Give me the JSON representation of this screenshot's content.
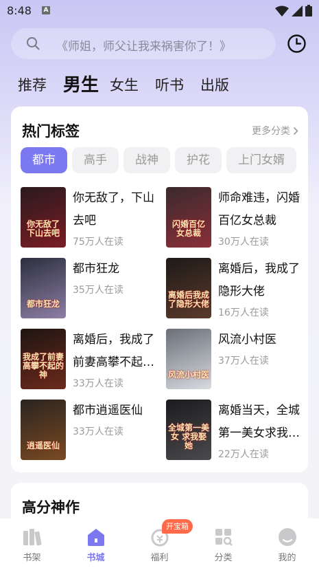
{
  "status": {
    "time": "8:48",
    "app_indicator": "A"
  },
  "search": {
    "placeholder": "《师姐，师父让我来祸害你了！》"
  },
  "categories": [
    {
      "label": "推荐",
      "active": false
    },
    {
      "label": "男生",
      "active": true
    },
    {
      "label": "女生",
      "active": false
    },
    {
      "label": "听书",
      "active": false
    },
    {
      "label": "出版",
      "active": false
    }
  ],
  "hot_tags": {
    "title": "热门标签",
    "more_label": "更多分类",
    "tags": [
      "都市",
      "高手",
      "战神",
      "护花",
      "上门女婿"
    ],
    "active_tag": "都市",
    "books": [
      {
        "title": "你无敌了，下山去吧",
        "readers": "75万人在读",
        "cover_text": "你无敌了 下山去吧",
        "cover_colors": [
          "#2a1a1e",
          "#7a1d24"
        ]
      },
      {
        "title": "师命难违，闪婚百亿女总裁",
        "readers": "30万人在读",
        "cover_text": "闪婚百亿 女总裁",
        "cover_colors": [
          "#3a2a2c",
          "#8a2f3a"
        ]
      },
      {
        "title": "都市狂龙",
        "readers": "35万人在读",
        "cover_text": "都市狂龙",
        "cover_colors": [
          "#2c2f3e",
          "#8d7fa6"
        ]
      },
      {
        "title": "离婚后，我成了隐形大佬",
        "readers": "16万人在读",
        "cover_text": "离婚后我成了隐形大佬",
        "cover_colors": [
          "#1e1a18",
          "#5a3a2a"
        ]
      },
      {
        "title": "离婚后，我成了前妻高攀不起的神",
        "readers": "33万人在读",
        "cover_text": "我成了前妻 高攀不起的神",
        "cover_colors": [
          "#1f1512",
          "#6b2a1c"
        ]
      },
      {
        "title": "风流小村医",
        "readers": "37万人在读",
        "cover_text": "风流小村医",
        "cover_colors": [
          "#6a6f78",
          "#d8dbe0"
        ]
      },
      {
        "title": "都市逍遥医仙",
        "readers": "33万人在读",
        "cover_text": "逍遥医仙",
        "cover_colors": [
          "#2a2420",
          "#7a4a22"
        ]
      },
      {
        "title": "离婚当天，全城第一美女求我娶她",
        "readers": "22万人在读",
        "cover_text": "全城第一美女 求我娶她",
        "cover_colors": [
          "#1c1c1e",
          "#4a4a4e"
        ]
      }
    ]
  },
  "high_score": {
    "title": "高分神作"
  },
  "bottom_nav": {
    "items": [
      {
        "label": "书架",
        "icon": "bookshelf-icon",
        "active": false
      },
      {
        "label": "书城",
        "icon": "bookstore-icon",
        "active": true
      },
      {
        "label": "福利",
        "icon": "gift-icon",
        "active": false
      },
      {
        "label": "分类",
        "icon": "category-icon",
        "active": false
      },
      {
        "label": "我的",
        "icon": "profile-icon",
        "active": false
      }
    ],
    "badge": "开宝箱"
  },
  "colors": {
    "accent": "#7c78ef",
    "badge": "#ff6a4a",
    "muted_text": "#9a9a9a"
  }
}
